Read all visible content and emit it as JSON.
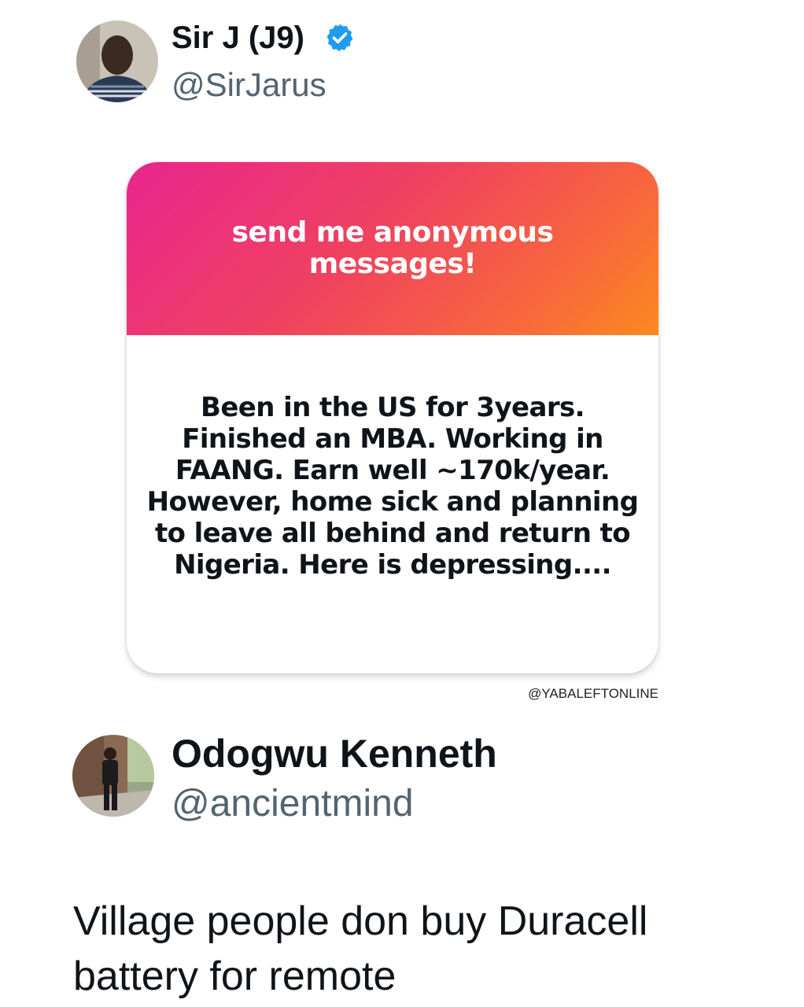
{
  "tweet1": {
    "display_name": "Sir J (J9)",
    "handle": "@SirJarus",
    "verified": true,
    "avatar_icon": "profile-photo"
  },
  "card": {
    "title": "send me anonymous messages!",
    "message": "Been in the US for 3years. Finished an MBA. Working in FAANG. Earn well ~170k/year. However, home sick and planning to leave all behind and return to Nigeria. Here is depressing....",
    "colors": {
      "gradient_start": "#e8258e",
      "gradient_mid": "#f0425f",
      "gradient_end": "#fb8a1e"
    }
  },
  "watermark": "@YABALEFTONLINE",
  "tweet2": {
    "display_name": "Odogwu Kenneth",
    "handle": "@ancientmind",
    "avatar_icon": "profile-photo",
    "text": "Village people don buy Duracell battery for remote"
  },
  "colors": {
    "verified_badge": "#1d9bf0",
    "handle_gray": "#536471"
  }
}
